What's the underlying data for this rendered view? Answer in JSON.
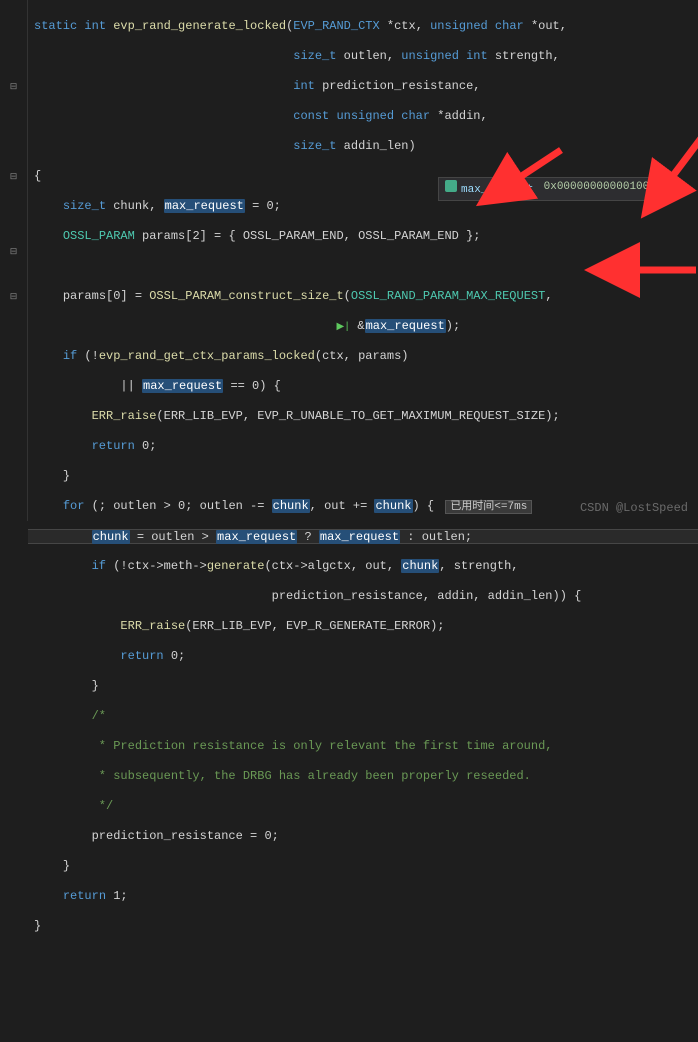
{
  "code": {
    "sig_static": "static",
    "sig_int": "int",
    "sig_name": "evp_rand_generate_locked",
    "sig_p1_type": "EVP_RAND_CTX",
    "sig_p1_name": "*ctx",
    "sig_p2_type": "unsigned char",
    "sig_p2_name": "*out",
    "sig_p3_type": "size_t",
    "sig_p3_name": "outlen",
    "sig_p4_type": "unsigned int",
    "sig_p4_name": "strength",
    "sig_p5_type": "int",
    "sig_p5_name": "prediction_resistance",
    "sig_p6_type": "const unsigned char",
    "sig_p6_name": "*addin",
    "sig_p7_type": "size_t",
    "sig_p7_name": "addin_len",
    "decl_sizet": "size_t",
    "decl_chunk": "chunk",
    "decl_maxreq": "max_request",
    "decl_eq0": " = 0;",
    "ossl_param": "OSSL_PARAM",
    "params_decl": " params[2] = { OSSL_PARAM_END, OSSL_PARAM_END };",
    "params0_lhs": "params[0] = ",
    "construct_fn": "OSSL_PARAM_construct_size_t",
    "max_const": "OSSL_RAND_PARAM_MAX_REQUEST",
    "amp_maxreq_pre": "&",
    "amp_maxreq_var": "max_request",
    "amp_maxreq_post": ");",
    "exec_glyph": "▶|",
    "if_kw": "if",
    "not_op": " (!",
    "getctx_fn": "evp_rand_get_ctx_params_locked",
    "getctx_args": "(ctx, params)",
    "or_op": "|| ",
    "maxreq_var2": "max_request",
    "eq0_cmp": " == 0) {",
    "err_raise": "ERR_raise",
    "err_args1": "(ERR_LIB_EVP, EVP_R_UNABLE_TO_GET_MAXIMUM_REQUEST_SIZE);",
    "return_kw": "return",
    "return_0": " 0;",
    "brace_close": "}",
    "for_kw": "for",
    "for_head_pre": " (; outlen > 0; outlen -= ",
    "for_head_mid": ", out += ",
    "for_head_post": ") { ",
    "chunk_var": "chunk",
    "time_label": "已用时间<=7ms",
    "chunk_assign_pre": " = outlen > ",
    "chunk_assign_q": " ? ",
    "chunk_assign_post": " : outlen;",
    "if2_pre": " (!ctx->meth->",
    "generate_fn": "generate",
    "gen_args1": "(ctx->algctx, out, ",
    "gen_args2": ", strength,",
    "gen_args3": "prediction_resistance, addin, addin_len)) {",
    "err_args2": "(ERR_LIB_EVP, EVP_R_GENERATE_ERROR);",
    "comment_open": "/*",
    "comment_l1": " * Prediction resistance is only relevant the first time around,",
    "comment_l2": " * subsequently, the DRBG has already been properly reseeded.",
    "comment_close": " */",
    "pred_reset": "prediction_resistance = 0;",
    "return_1": " 1;"
  },
  "tooltip": {
    "name": "max_request",
    "value": "0x0000000000010000"
  },
  "watermark": "CSDN @LostSpeed"
}
